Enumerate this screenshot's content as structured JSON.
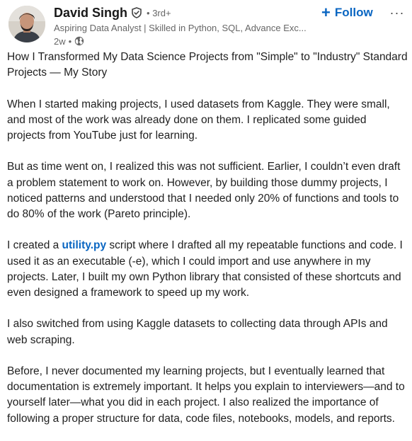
{
  "author": {
    "name": "David Singh",
    "degree": "3rd+",
    "headline": "Aspiring Data Analyst | Skilled in Python, SQL, Advance Exc...",
    "age": "2w",
    "bullet": "•",
    "degree_bullet": "•"
  },
  "actions": {
    "follow_plus": "+",
    "follow_label": "Follow",
    "more_label": "···"
  },
  "post": {
    "p1": "How I Transformed My Data Science Projects from \"Simple\" to \"Industry\" Standard Projects — My Story",
    "p2": "When I started making projects, I used datasets from Kaggle. They were small, and most of the work was already done on them. I replicated some guided projects from YouTube just for learning.",
    "p3": "But as time went on, I realized this was not sufficient. Earlier, I couldn’t even draft a problem statement to work on. However, by building those dummy projects, I noticed patterns and understood that I needed only 20% of functions and tools to do 80% of the work (Pareto principle).",
    "p4_before": "I created a ",
    "p4_link": "utility.py",
    "p4_after": " script where I drafted all my repeatable functions and code. I used it as an executable (-e), which I could import and use anywhere in my projects. Later, I built my own Python library that consisted of these shortcuts and even designed a framework to speed up my work.",
    "p5": "I also switched from using Kaggle datasets to collecting data through APIs and web scraping.",
    "p6": "Before, I never documented my learning projects, but I eventually learned that documentation is extremely important. It helps you explain to interviewers—and to yourself later—what you did in each project. I also realized the importance of following a proper structure for data, code files, notebooks, models, and reports."
  },
  "icons": {
    "verified": "verified-shield-icon",
    "globe": "globe-icon",
    "more": "more-horizontal-icon"
  },
  "colors": {
    "link": "#0a66c2",
    "text": "#1f1f1f",
    "muted": "#666666"
  }
}
